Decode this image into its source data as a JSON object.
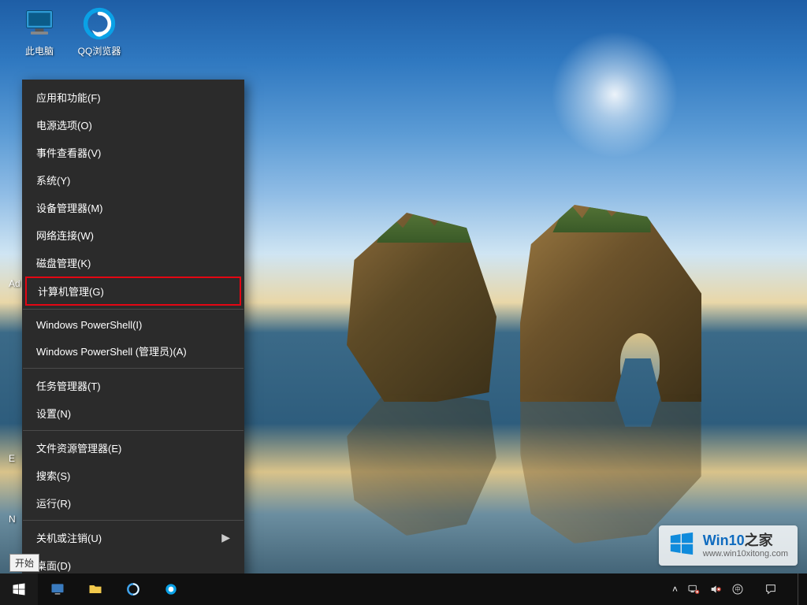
{
  "desktop_icons": {
    "this_pc": "此电脑",
    "qq_browser": "QQ浏览器",
    "admin_partial": "Ad",
    "edge_label_E": "E",
    "edge_label_N": "N"
  },
  "winx_menu": {
    "items_group1": [
      "应用和功能(F)",
      "电源选项(O)",
      "事件查看器(V)",
      "系统(Y)",
      "设备管理器(M)",
      "网络连接(W)",
      "磁盘管理(K)"
    ],
    "highlighted": "计算机管理(G)",
    "items_group2": [
      "Windows PowerShell(I)",
      "Windows PowerShell (管理员)(A)"
    ],
    "items_group3": [
      "任务管理器(T)",
      "设置(N)"
    ],
    "items_group4": [
      "文件资源管理器(E)",
      "搜索(S)",
      "运行(R)"
    ],
    "items_group5": [
      {
        "label": "关机或注销(U)",
        "submenu": true
      },
      {
        "label": "桌面(D)",
        "submenu": false
      }
    ]
  },
  "start_tooltip": "开始",
  "watermark": {
    "title_main": "Win10",
    "title_suffix": "之家",
    "url": "www.win10xitong.com"
  },
  "colors": {
    "menu_bg": "#2b2b2b",
    "highlight_border": "#e30613",
    "win_blue": "#0078d7"
  }
}
